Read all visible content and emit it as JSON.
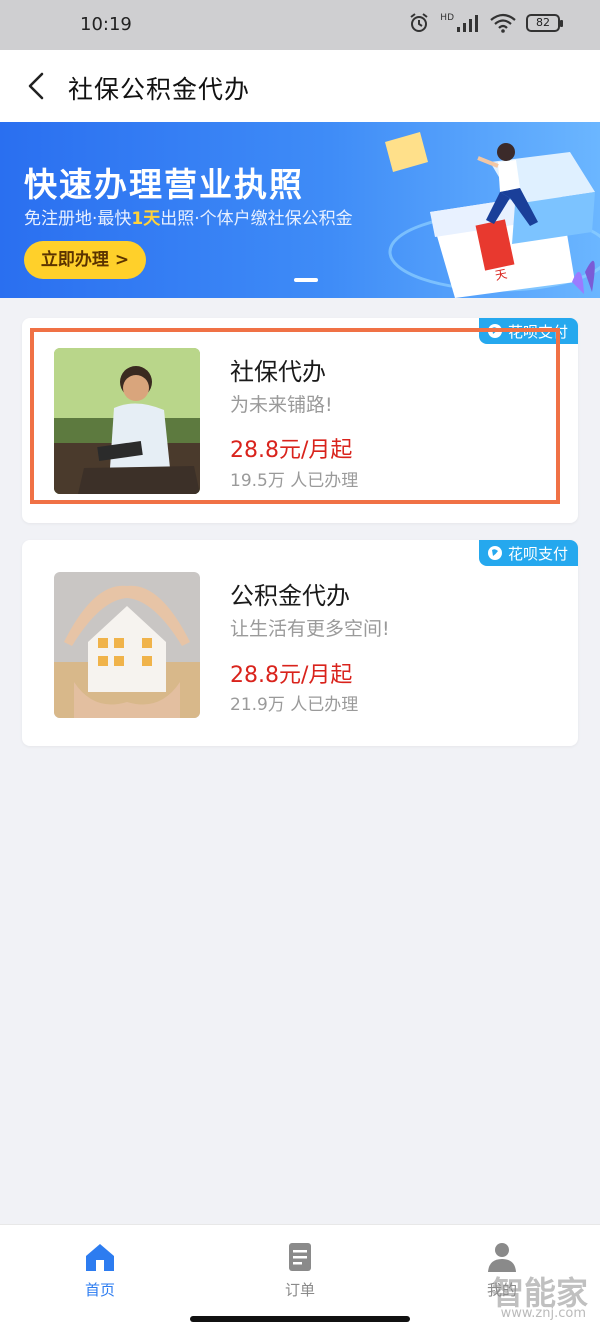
{
  "status_bar": {
    "time": "10:19",
    "battery": "82",
    "network": "HD"
  },
  "header": {
    "title": "社保公积金代办"
  },
  "banner": {
    "title": "快速办理营业执照",
    "subtitle_pre": "免注册地·最快",
    "subtitle_highlight": "1天",
    "subtitle_post": "出照·个体户缴社保公积金",
    "button_label": "立即办理 >",
    "art_tag": "天"
  },
  "services": [
    {
      "title": "社保代办",
      "subtitle": "为未来铺路!",
      "price": "28.8元/月起",
      "count": "19.5万 人已办理",
      "badge": "花呗支付"
    },
    {
      "title": "公积金代办",
      "subtitle": "让生活有更多空间!",
      "price": "28.8元/月起",
      "count": "21.9万 人已办理",
      "badge": "花呗支付"
    }
  ],
  "bottom_nav": {
    "home": "首页",
    "orders": "订单",
    "mine": "我的"
  },
  "watermark": {
    "text": "智能家",
    "url": "www.znj.com"
  },
  "colors": {
    "accent": "#2d7cf0",
    "price": "#d9231c",
    "badge": "#25a8ee",
    "highlight_box": "#f07145",
    "banner_button": "#ffd02a"
  }
}
